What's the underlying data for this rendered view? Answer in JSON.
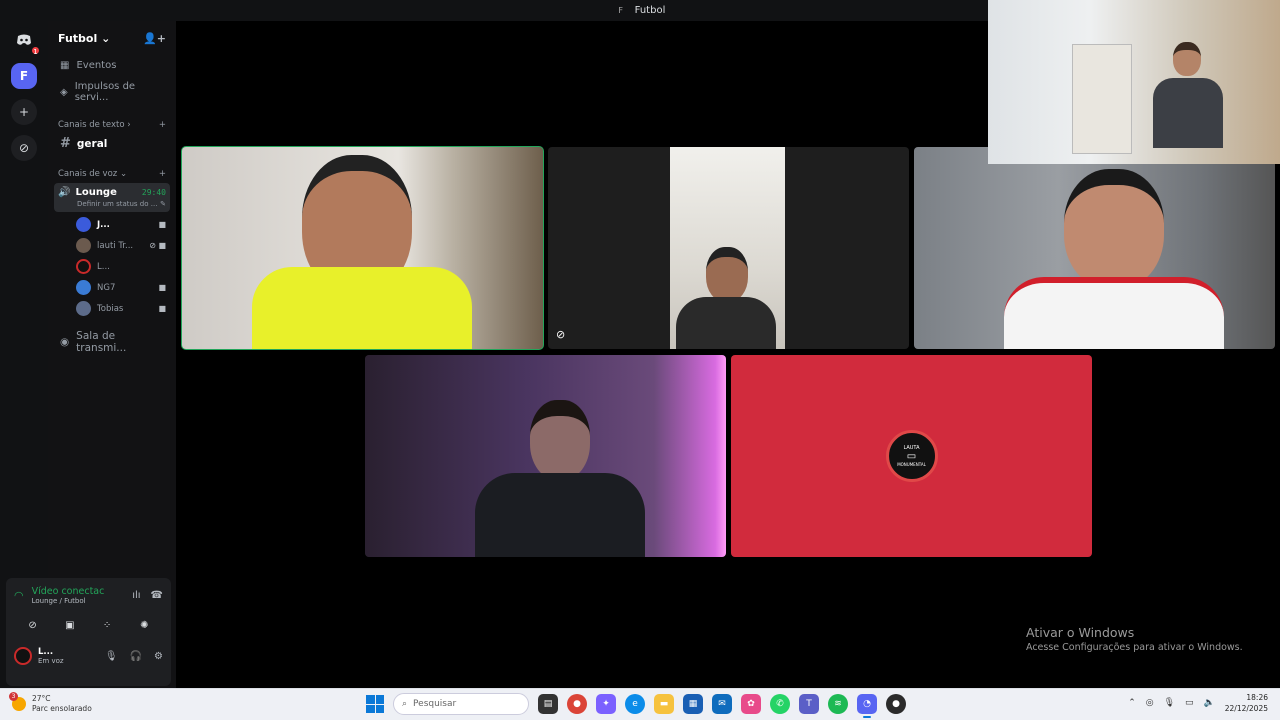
{
  "window": {
    "title": "Futbol",
    "title_icon": "F"
  },
  "rail": {
    "notification_count": "1",
    "server_initial": "F"
  },
  "server": {
    "name": "Futbol",
    "nav": [
      {
        "label": "Eventos"
      },
      {
        "label": "Impulsos de servi..."
      }
    ],
    "text_section": "Canais de texto",
    "text_channels": [
      {
        "name": "geral"
      }
    ],
    "voice_section": "Canais de voz",
    "voice_channel": {
      "name": "Lounge",
      "timer": "29:40",
      "status": "Definir um status do ..."
    },
    "members": [
      {
        "name": "J...",
        "color": "#3b5bdb"
      },
      {
        "name": "lauti Tr...",
        "color": "#6b5a4e"
      },
      {
        "name": "L...",
        "color": "#c92a2a"
      },
      {
        "name": "NG7",
        "color": "#3a7bd5"
      },
      {
        "name": "Tobias",
        "color": "#5c6b8a"
      }
    ],
    "stage_channel": "Sala de transmi..."
  },
  "voice_panel": {
    "status": "Vídeo conectac",
    "location": "Lounge / Futbol"
  },
  "user": {
    "name": "L...",
    "status": "Em voz"
  },
  "stage_logo": {
    "top": "LAUTA",
    "bottom": "MONUMENTAL"
  },
  "windows_activation": {
    "title": "Ativar o Windows",
    "subtitle": "Acesse Configurações para ativar o Windows."
  },
  "taskbar": {
    "weather_temp": "27°C",
    "weather_desc": "Parc ensolarado",
    "weather_badge": "3",
    "search_placeholder": "Pesquisar",
    "time": "18:26",
    "date": "22/12/2025"
  },
  "colors": {
    "accent": "#5865f2",
    "speaking": "#23a55a",
    "stage_red": "#d12b3d"
  }
}
